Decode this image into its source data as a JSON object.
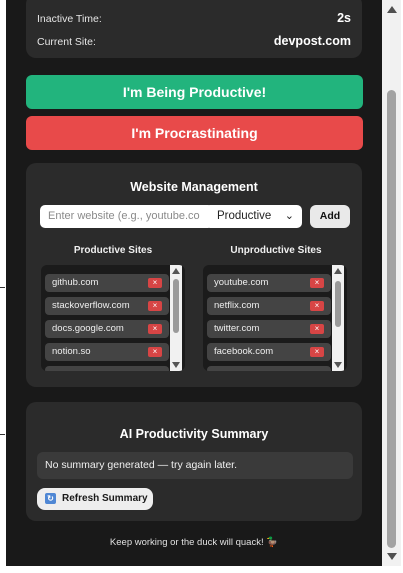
{
  "stats": {
    "inactive_label": "Inactive Time:",
    "inactive_value": "2s",
    "site_label": "Current Site:",
    "site_value": "devpost.com"
  },
  "actions": {
    "productive_label": "I'm Being Productive!",
    "procrastinating_label": "I'm Procrastinating"
  },
  "management": {
    "title": "Website Management",
    "input_placeholder": "Enter website (e.g., youtube.co",
    "select_value": "Productive",
    "add_label": "Add",
    "productive_title": "Productive Sites",
    "unproductive_title": "Unproductive Sites",
    "productive_sites": [
      "github.com",
      "stackoverflow.com",
      "docs.google.com",
      "notion.so"
    ],
    "unproductive_sites": [
      "youtube.com",
      "netflix.com",
      "twitter.com",
      "facebook.com"
    ],
    "remove_symbol": "×"
  },
  "summary": {
    "title": "AI Productivity Summary",
    "text": "No summary generated — try again later.",
    "refresh_label": "Refresh Summary"
  },
  "footer": "Keep working or the duck will quack! 🦆",
  "colors": {
    "productive": "#22b47d",
    "procrastinating": "#e84a4a",
    "remove": "#d74545"
  }
}
